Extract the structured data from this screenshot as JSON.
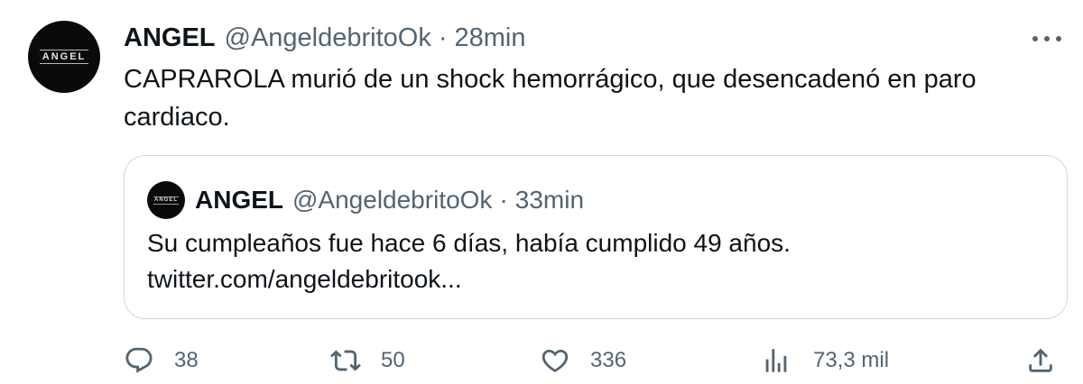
{
  "tweet": {
    "avatar_text": "ANGEL",
    "name": "ANGEL",
    "handle": "@AngeldebritoOk",
    "separator": "·",
    "time": "28min",
    "text": "CAPRAROLA murió de un shock hemorrágico, que desencadenó en paro cardiaco."
  },
  "quote": {
    "avatar_text": "ANGEL",
    "name": "ANGEL",
    "handle": "@AngeldebritoOk",
    "separator": "·",
    "time": "33min",
    "text_line1": "Su cumpleaños fue hace 6 días, había cumplido 49 años.",
    "text_line2": "twitter.com/angeldebritook..."
  },
  "actions": {
    "replies": "38",
    "retweets": "50",
    "likes": "336",
    "views": "73,3 mil"
  },
  "icons": {
    "more": "more-horizontal-icon",
    "reply": "reply-icon",
    "retweet": "retweet-icon",
    "like": "heart-icon",
    "views": "analytics-icon",
    "share": "share-icon"
  },
  "colors": {
    "text_primary": "#0f1419",
    "text_secondary": "#536471",
    "border": "#cfd9de"
  }
}
